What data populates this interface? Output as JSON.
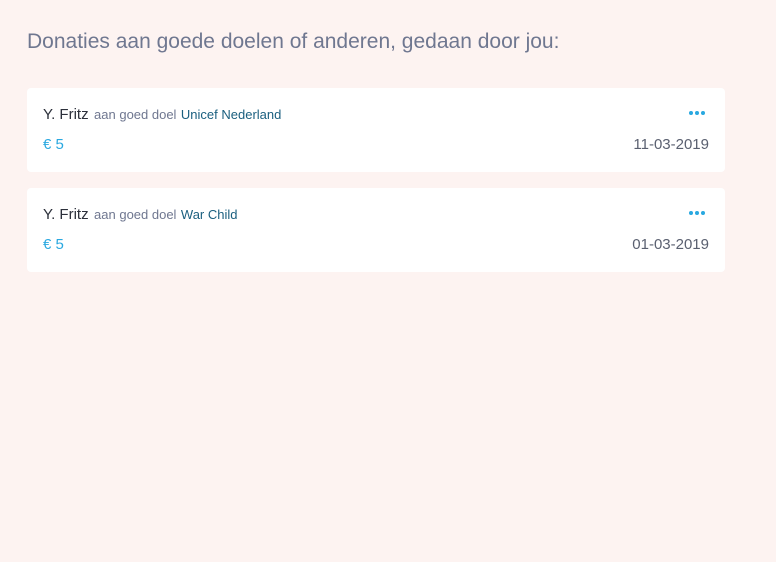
{
  "page": {
    "title": "Donaties aan goede doelen of anderen, gedaan door jou:"
  },
  "colors": {
    "background": "#fdf3f1",
    "card": "#ffffff",
    "amount": "#29a8e0",
    "link": "#1a5f7f",
    "menu_dots": "#29a8e0"
  },
  "donations": [
    {
      "donor": "Y. Fritz",
      "connector": "aan goed doel",
      "cause": "Unicef Nederland",
      "amount": "€ 5",
      "date": "11-03-2019",
      "menu_icon": "more-horizontal-icon"
    },
    {
      "donor": "Y. Fritz",
      "connector": "aan goed doel",
      "cause": "War Child",
      "amount": "€ 5",
      "date": "01-03-2019",
      "menu_icon": "more-horizontal-icon"
    }
  ]
}
